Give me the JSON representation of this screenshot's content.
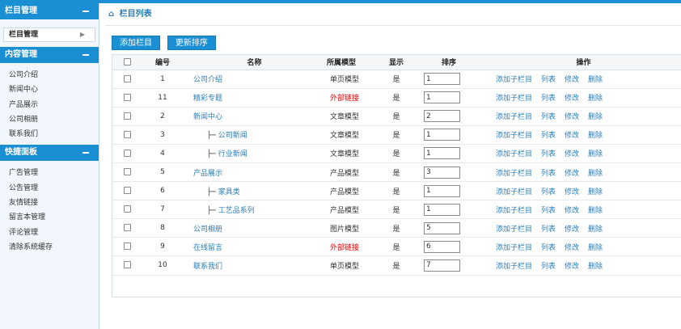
{
  "sidebar": {
    "sections": [
      {
        "title": "栏目管理",
        "active_item": "栏目管理",
        "items": []
      },
      {
        "title": "内容管理",
        "items": [
          "公司介绍",
          "新闻中心",
          "产品展示",
          "公司相册",
          "联系我们"
        ]
      },
      {
        "title": "快捷面板",
        "items": [
          "广告管理",
          "公告管理",
          "友情链接",
          "留言本管理",
          "评论管理",
          "清除系统缓存"
        ]
      }
    ]
  },
  "breadcrumb": {
    "title": "栏目列表"
  },
  "toolbar": {
    "add_label": "添加栏目",
    "sort_label": "更新排序"
  },
  "table": {
    "headers": [
      "编号",
      "名称",
      "所属模型",
      "显示",
      "排序",
      "操作"
    ],
    "ops": [
      "添加子栏目",
      "列表",
      "修改",
      "删除"
    ],
    "rows": [
      {
        "id": "1",
        "name": "公司介绍",
        "prefix": "",
        "model": "单页模型",
        "model_red": false,
        "show": "是",
        "sort": "1"
      },
      {
        "id": "11",
        "name": "精彩专题",
        "prefix": "",
        "model": "外部链接",
        "model_red": true,
        "show": "是",
        "sort": "1"
      },
      {
        "id": "2",
        "name": "新闻中心",
        "prefix": "",
        "model": "文章模型",
        "model_red": false,
        "show": "是",
        "sort": "2"
      },
      {
        "id": "3",
        "name": "公司新闻",
        "prefix": "├─ ",
        "model": "文章模型",
        "model_red": false,
        "show": "是",
        "sort": "1"
      },
      {
        "id": "4",
        "name": "行业新闻",
        "prefix": "├─ ",
        "model": "文章模型",
        "model_red": false,
        "show": "是",
        "sort": "1"
      },
      {
        "id": "5",
        "name": "产品展示",
        "prefix": "",
        "model": "产品模型",
        "model_red": false,
        "show": "是",
        "sort": "3"
      },
      {
        "id": "6",
        "name": "家具类",
        "prefix": "├─ ",
        "model": "产品模型",
        "model_red": false,
        "show": "是",
        "sort": "1"
      },
      {
        "id": "7",
        "name": "工艺品系列",
        "prefix": "├─ ",
        "model": "产品模型",
        "model_red": false,
        "show": "是",
        "sort": "1"
      },
      {
        "id": "8",
        "name": "公司相册",
        "prefix": "",
        "model": "图片模型",
        "model_red": false,
        "show": "是",
        "sort": "5"
      },
      {
        "id": "9",
        "name": "在线留言",
        "prefix": "",
        "model": "外部链接",
        "model_red": true,
        "show": "是",
        "sort": "6"
      },
      {
        "id": "10",
        "name": "联系我们",
        "prefix": "",
        "model": "单页模型",
        "model_red": false,
        "show": "是",
        "sort": "7"
      }
    ]
  },
  "colors": {
    "accent": "#1b8fd4",
    "link": "#2a7db7",
    "warn": "#ee0000"
  }
}
